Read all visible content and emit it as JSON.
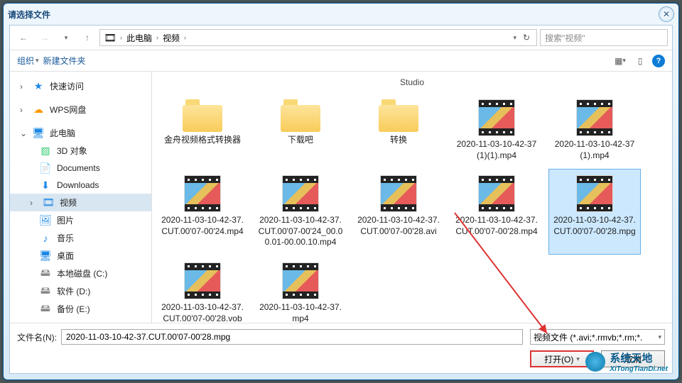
{
  "title": "请选择文件",
  "nav": {
    "pc": "此电脑",
    "videos": "视频",
    "search_placeholder": "搜索\"视频\""
  },
  "toolbar": {
    "organize": "组织",
    "newfolder": "新建文件夹"
  },
  "sidebar": {
    "quick": "快速访问",
    "wps": "WPS网盘",
    "pc": "此电脑",
    "desktop_3d": "3D 对象",
    "docs": "Documents",
    "downloads": "Downloads",
    "videos": "视频",
    "pictures": "图片",
    "music": "音乐",
    "desktop": "桌面",
    "cdrive": "本地磁盘 (C:)",
    "ddrive": "软件 (D:)",
    "edrive": "备份 (E:)"
  },
  "group": "Studio",
  "items": [
    {
      "type": "folder",
      "label": "金舟视频格式转换器"
    },
    {
      "type": "folder",
      "label": "下载吧"
    },
    {
      "type": "folder",
      "label": "转换"
    },
    {
      "type": "video",
      "label": "2020-11-03-10-42-37(1)(1).mp4"
    },
    {
      "type": "video",
      "label": "2020-11-03-10-42-37(1).mp4"
    },
    {
      "type": "video",
      "label": "2020-11-03-10-42-37.CUT.00'07-00'24.mp4"
    },
    {
      "type": "video",
      "label": "2020-11-03-10-42-37.CUT.00'07-00'24_00.00.01-00.00.10.mp4"
    },
    {
      "type": "video",
      "label": "2020-11-03-10-42-37.CUT.00'07-00'28.avi"
    },
    {
      "type": "video",
      "label": "2020-11-03-10-42-37.CUT.00'07-00'28.mp4"
    },
    {
      "type": "video",
      "label": "2020-11-03-10-42-37.CUT.00'07-00'28.mpg"
    },
    {
      "type": "video",
      "label": "2020-11-03-10-42-37.CUT.00'07-00'28.vob"
    },
    {
      "type": "video",
      "label": "2020-11-03-10-42-37.mp4"
    }
  ],
  "selected_index": 9,
  "footer": {
    "fn_label": "文件名(N):",
    "fn_value": "2020-11-03-10-42-37.CUT.00'07-00'28.mpg",
    "filter": "视频文件  (*.avi;*.rmvb;*.rm;*.",
    "open": "打开(O)",
    "cancel": "取消"
  },
  "watermark": {
    "line1": "系统天地",
    "line2": "XiTongTianDi.net"
  }
}
